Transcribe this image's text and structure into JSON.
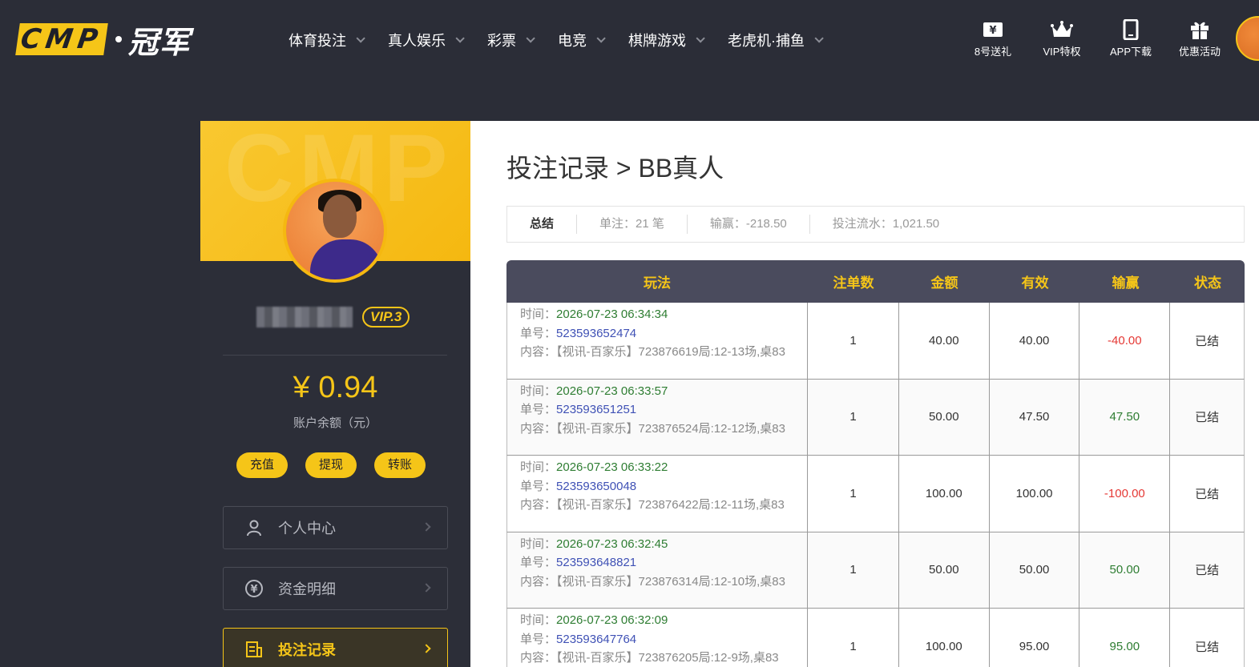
{
  "header": {
    "logo_text": "CMP",
    "logo_cn": "冠军",
    "nav": [
      {
        "label": "体育投注"
      },
      {
        "label": "真人娱乐"
      },
      {
        "label": "彩票"
      },
      {
        "label": "电竞"
      },
      {
        "label": "棋牌游戏"
      },
      {
        "label": "老虎机·捕鱼"
      }
    ],
    "tools": [
      {
        "label": "8号送礼",
        "icon": "ticket-icon"
      },
      {
        "label": "VIP特权",
        "icon": "crown-icon"
      },
      {
        "label": "APP下载",
        "icon": "phone-icon"
      },
      {
        "label": "优惠活动",
        "icon": "gift-icon"
      }
    ]
  },
  "sidebar": {
    "banner_text": "CMP",
    "vip": "VIP.3",
    "balance": "¥ 0.94",
    "balance_label": "账户余额（元）",
    "buttons": [
      "充值",
      "提现",
      "转账"
    ],
    "menu": [
      {
        "label": "个人中心",
        "icon": "user-icon"
      },
      {
        "label": "资金明细",
        "icon": "yuan-circle-icon"
      },
      {
        "label": "投注记录",
        "icon": "record-icon",
        "active": true
      }
    ]
  },
  "main": {
    "title": "投注记录 > BB真人",
    "summary": {
      "total_label": "总结",
      "bets": "单注：21 笔",
      "winloss": "输赢：-218.50",
      "turnover": "投注流水：1,021.50"
    },
    "columns": [
      "玩法",
      "注单数",
      "金额",
      "有效",
      "输赢",
      "状态"
    ],
    "labels": {
      "time": "时间：",
      "order": "单号：",
      "content": "内容："
    },
    "rows": [
      {
        "time": "2026-07-23 06:34:34",
        "order": "523593652474",
        "content": "【视讯-百家乐】723876619局:12-13场,桌83",
        "count": "1",
        "amount": "40.00",
        "valid": "40.00",
        "winloss": "-40.00",
        "status": "已结"
      },
      {
        "time": "2026-07-23 06:33:57",
        "order": "523593651251",
        "content": "【视讯-百家乐】723876524局:12-12场,桌83",
        "count": "1",
        "amount": "50.00",
        "valid": "47.50",
        "winloss": "47.50",
        "status": "已结"
      },
      {
        "time": "2026-07-23 06:33:22",
        "order": "523593650048",
        "content": "【视讯-百家乐】723876422局:12-11场,桌83",
        "count": "1",
        "amount": "100.00",
        "valid": "100.00",
        "winloss": "-100.00",
        "status": "已结"
      },
      {
        "time": "2026-07-23 06:32:45",
        "order": "523593648821",
        "content": "【视讯-百家乐】723876314局:12-10场,桌83",
        "count": "1",
        "amount": "50.00",
        "valid": "50.00",
        "winloss": "50.00",
        "status": "已结"
      },
      {
        "time": "2026-07-23 06:32:09",
        "order": "523593647764",
        "content": "【视讯-百家乐】723876205局:12-9场,桌83",
        "count": "1",
        "amount": "100.00",
        "valid": "95.00",
        "winloss": "95.00",
        "status": "已结"
      }
    ]
  }
}
